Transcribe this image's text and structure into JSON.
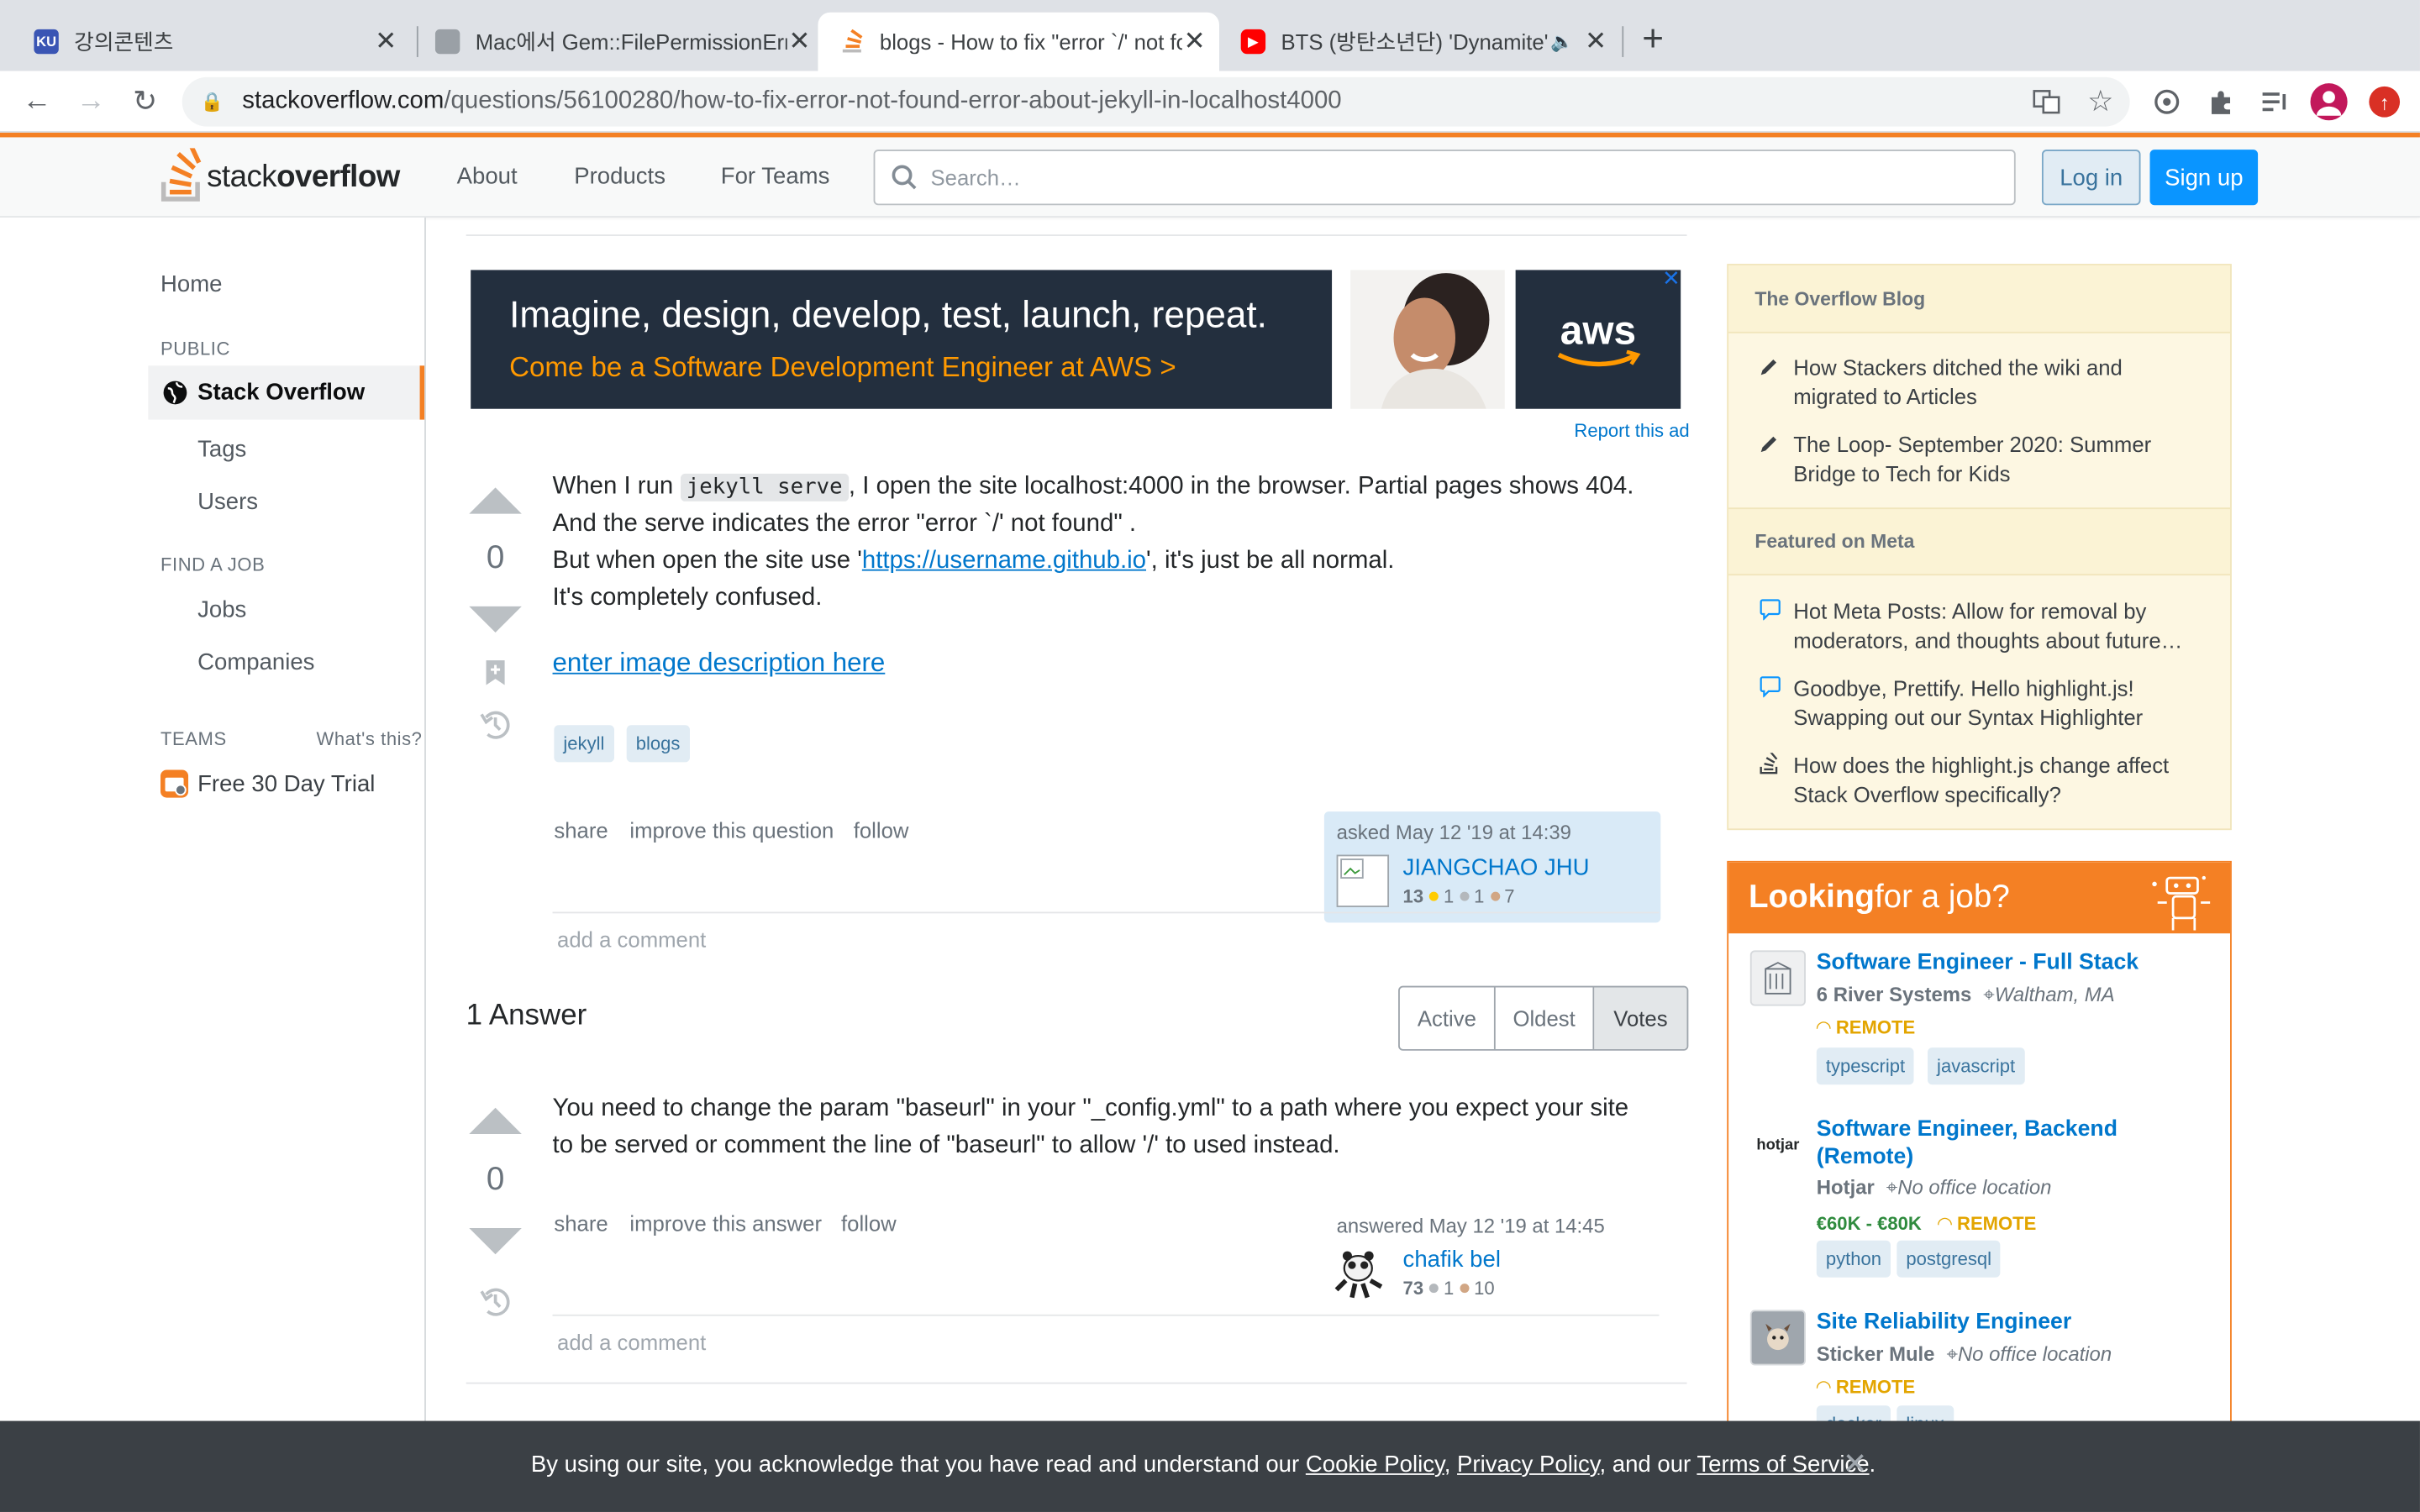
{
  "browser": {
    "tabs": [
      {
        "title": "강의콘텐츠",
        "favicon": "KU",
        "favicon_color": "#3a55b4"
      },
      {
        "title": "Mac에서 Gem::FilePermissionError",
        "favicon": "",
        "favicon_color": "#5f6368"
      },
      {
        "title": "blogs - How to fix \"error `/' not found\"",
        "favicon": "",
        "favicon_color": "#f48024"
      },
      {
        "title": "BTS (방탄소년단) 'Dynamite' Official MV",
        "favicon": "▶",
        "favicon_color": "#ff0000"
      }
    ],
    "url_host": "stackoverflow.com",
    "url_path": "/questions/56100280/how-to-fix-error-not-found-error-about-jekyll-in-localhost4000"
  },
  "header": {
    "logo_light": "stack",
    "logo_bold": "overflow",
    "nav": [
      "About",
      "Products",
      "For Teams"
    ],
    "search_placeholder": "Search…",
    "login": "Log in",
    "signup": "Sign up"
  },
  "leftnav": {
    "home": "Home",
    "public_heading": "PUBLIC",
    "stack_overflow": "Stack Overflow",
    "tags": "Tags",
    "users": "Users",
    "find_job_heading": "FIND A JOB",
    "jobs": "Jobs",
    "companies": "Companies",
    "teams_heading": "TEAMS",
    "whats_this": "What's this?",
    "free_trial": "Free 30 Day Trial"
  },
  "ad": {
    "line1": "Imagine, design, develop, test, launch, repeat.",
    "line2": "Come be a Software Development Engineer at AWS >",
    "brand": "aws",
    "report": "Report this ad"
  },
  "question": {
    "votes": "0",
    "line1_pre": "When I run ",
    "line1_code": "jekyll serve",
    "line1_post": ", I open the site localhost:4000 in the browser. Partial pages shows 404.",
    "line2": "And the serve indicates the error \"error `/' not found\" .",
    "line3_pre": "But when open the site use '",
    "line3_link": "https://username.github.io",
    "line3_post": "', it's just be all normal.",
    "line4": "It's completely confused.",
    "image_link": "enter image description here",
    "tags": [
      "jekyll",
      "blogs"
    ],
    "menu": [
      "share",
      "improve this question",
      "follow"
    ],
    "asked": "asked May 12 '19 at 14:39",
    "author": "JIANGCHAO JHU",
    "rep": "13",
    "gold": "1",
    "silver": "1",
    "bronze": "7",
    "add_comment": "add a comment"
  },
  "answers": {
    "count_label": "1 Answer",
    "sort": [
      "Active",
      "Oldest",
      "Votes"
    ],
    "votes": "0",
    "line1": "You need to change the param \"baseurl\" in your \"_config.yml\" to a path where you expect your site",
    "line2": "to be served or comment the line of \"baseurl\" to allow '/' to used instead.",
    "menu": [
      "share",
      "improve this answer",
      "follow"
    ],
    "answered": "answered May 12 '19 at 14:45",
    "author": "chafik bel",
    "rep": "73",
    "silver": "1",
    "bronze": "10",
    "add_comment": "add a comment"
  },
  "sidebar": {
    "blog_heading": "The Overflow Blog",
    "blog_items": [
      "How Stackers ditched the wiki and migrated to Articles",
      "The Loop- September 2020: Summer Bridge to Tech for Kids"
    ],
    "meta_heading": "Featured on Meta",
    "meta_items": [
      "Hot Meta Posts: Allow for removal by moderators, and thoughts about future…",
      "Goodbye, Prettify. Hello highlight.js! Swapping out our Syntax Highlighter",
      "How does the highlight.js change affect Stack Overflow specifically?"
    ],
    "jobs_heading_bold": "Looking",
    "jobs_heading_rest": " for a job?",
    "jobs": [
      {
        "title": "Software Engineer - Full Stack",
        "company": "6 River Systems",
        "location": "Waltham, MA",
        "salary": "",
        "remote": "REMOTE",
        "tags": [
          "typescript",
          "javascript"
        ],
        "logo": "6RS"
      },
      {
        "title": "Software Engineer, Backend (Remote)",
        "company": "Hotjar",
        "location": "No office location",
        "salary": "€60K - €80K",
        "remote": "REMOTE",
        "tags": [
          "python",
          "postgresql"
        ],
        "logo": "hotjar"
      },
      {
        "title": "Site Reliability Engineer",
        "company": "Sticker Mule",
        "location": "No office location",
        "salary": "",
        "remote": "REMOTE",
        "tags": [
          "docker",
          "linux"
        ],
        "logo": "SM"
      }
    ]
  },
  "cookie": {
    "text_pre": "By using our site, you acknowledge that you have read and understand our ",
    "cookie_policy": "Cookie Policy",
    "sep1": ", ",
    "privacy_policy": "Privacy Policy",
    "sep2": ", and our ",
    "terms": "Terms of Service",
    "end": "."
  },
  "colors": {
    "so_orange": "#f48024",
    "link_blue": "#0077cc",
    "cookie_bg": "#3b4045"
  }
}
